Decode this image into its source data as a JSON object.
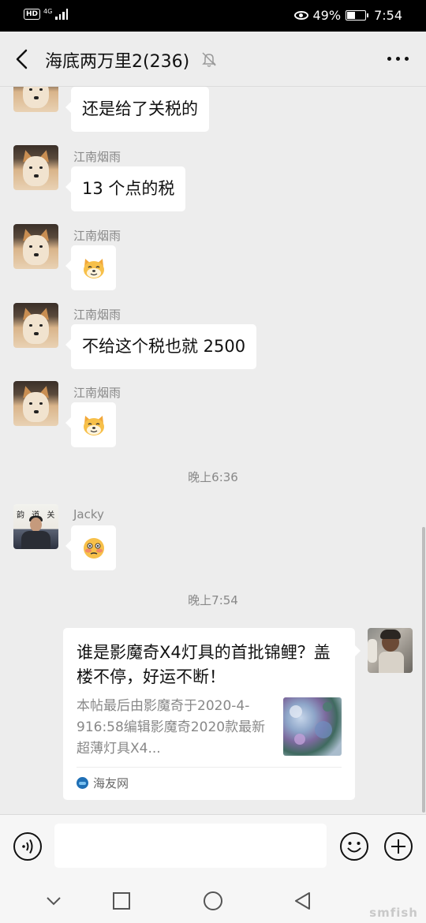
{
  "status_bar": {
    "network": "4G",
    "battery_percent": "49%",
    "battery_level": 0.49,
    "time": "7:54"
  },
  "header": {
    "title": "海底两万里2(236)",
    "muted_icon": "bell-off-icon",
    "more_icon": "more-dots-icon"
  },
  "messages": [
    {
      "sender": "",
      "text": "还是给了关税的",
      "avatar": "shiba"
    },
    {
      "sender": "江南烟雨",
      "text": "13 个点的税",
      "avatar": "shiba"
    },
    {
      "sender": "江南烟雨",
      "emoji": "dog-emoji",
      "avatar": "shiba"
    },
    {
      "sender": "江南烟雨",
      "text": "不给这个税也就 2500",
      "avatar": "shiba"
    },
    {
      "sender": "江南烟雨",
      "emoji": "dog-emoji",
      "avatar": "shiba"
    },
    {
      "sender": "Jacky",
      "emoji": "flushed-emoji",
      "avatar": "jacky"
    }
  ],
  "timestamps": [
    "晚上6:36",
    "晚上7:54"
  ],
  "shared_card": {
    "title": "谁是影魔奇X4灯具的首批锦鲤？盖楼不停，好运不断！",
    "description": "本帖最后由影魔奇于2020-4-916:58编辑影魔奇2020款最新超薄灯具X4...",
    "source": "海友网"
  },
  "input_bar": {
    "voice_icon": "voice-icon",
    "emoji_icon": "smiley-icon",
    "plus_icon": "plus-icon",
    "placeholder": ""
  },
  "nav_bar": {
    "icons": [
      "chevron-down-icon",
      "square-icon",
      "circle-icon",
      "triangle-back-icon"
    ]
  },
  "watermark": "smfish"
}
